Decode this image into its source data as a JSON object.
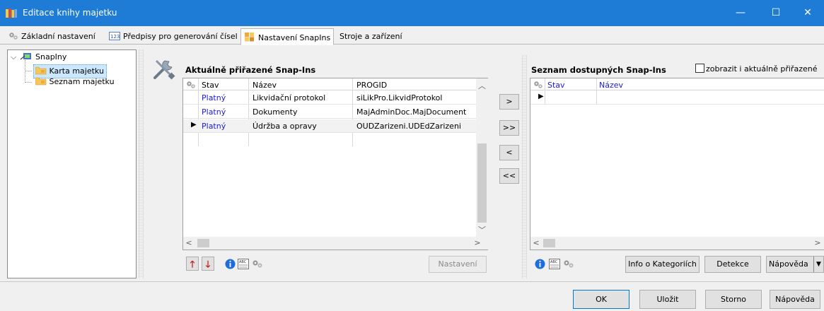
{
  "window": {
    "title": "Editace knihy majetku",
    "minimize": "—",
    "maximize": "☐",
    "close": "✕"
  },
  "tabs": [
    {
      "label": "Základní nastavení"
    },
    {
      "label": "Předpisy pro generování čísel"
    },
    {
      "label": "Nastavení SnapIns"
    },
    {
      "label": "Stroje a zařízení"
    }
  ],
  "tree": {
    "root": "SnapIny",
    "children": [
      {
        "label": "Karta majetku"
      },
      {
        "label": "Seznam majetku"
      }
    ]
  },
  "assigned": {
    "title": "Aktuálně přiřazené Snap-Ins",
    "columns": {
      "stav": "Stav",
      "nazev": "Název",
      "progid": "PROGID"
    },
    "rows": [
      {
        "stav": "Platný",
        "nazev": "Likvidační protokol",
        "progid": "siLikPro.LikvidProtokol"
      },
      {
        "stav": "Platný",
        "nazev": "Dokumenty",
        "progid": "MajAdminDoc.MajDocument"
      },
      {
        "stav": "Platný",
        "nazev": "Údržba a opravy",
        "progid": "OUDZarizeni.UDEdZarizeni"
      }
    ],
    "settings_button": "Nastavení"
  },
  "transfer": {
    "add": ">",
    "add_all": ">>",
    "remove": "<",
    "remove_all": "<<"
  },
  "available": {
    "title": "Seznam dostupných Snap-Ins",
    "show_assigned_label": "zobrazit i aktuálně přiřazené",
    "columns": {
      "stav": "Stav",
      "nazev": "Název"
    },
    "info_button": "Info o Kategoriích",
    "detect_button": "Detekce",
    "help_button": "Nápověda"
  },
  "footer": {
    "ok": "OK",
    "save": "Uložit",
    "cancel": "Storno",
    "help": "Nápověda"
  },
  "colors": {
    "titlebar": "#1e7bd6",
    "link_blue": "#1b1bd0",
    "selection": "#cce8ff"
  }
}
